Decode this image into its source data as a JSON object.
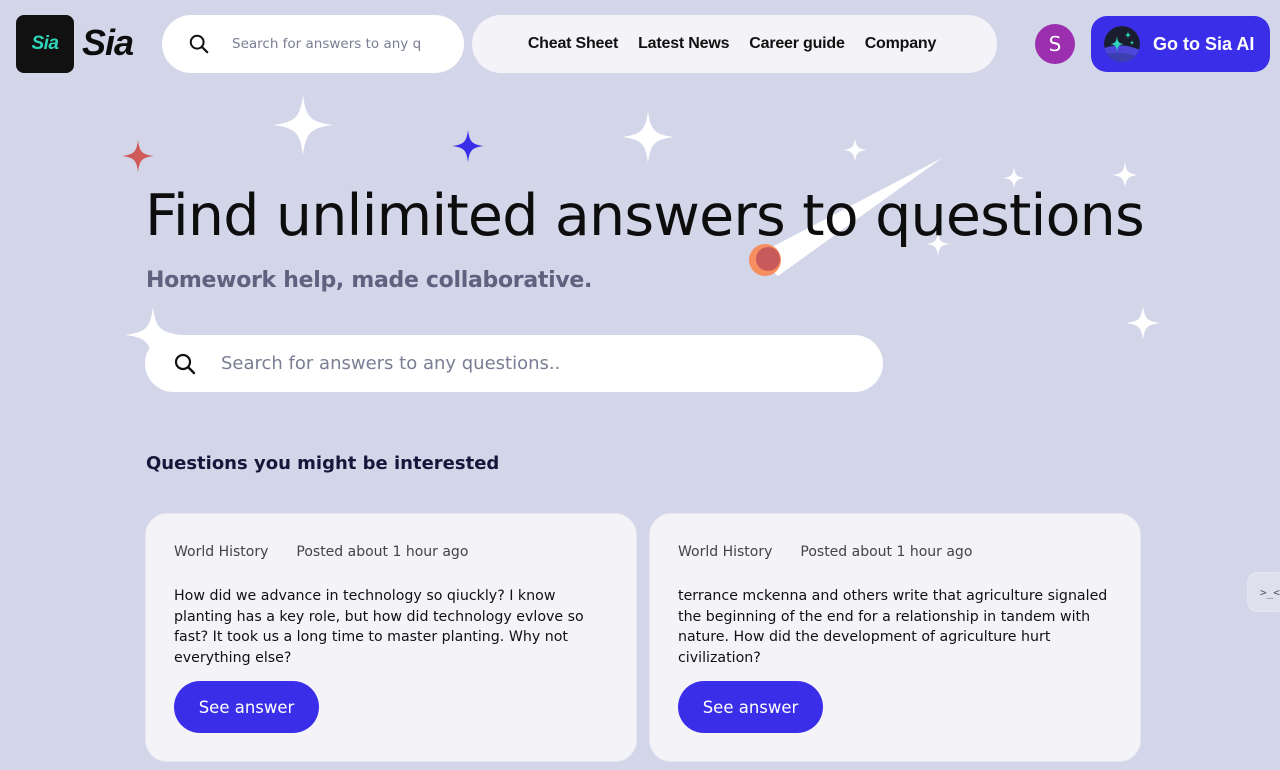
{
  "header": {
    "logo_badge_text": "Sia",
    "logo_wordmark": "Sia",
    "search": {
      "placeholder": "Search for answers to any questions..",
      "icon": "search-icon"
    },
    "nav": [
      {
        "label": "Cheat Sheet"
      },
      {
        "label": "Latest News"
      },
      {
        "label": "Career guide"
      },
      {
        "label": "Company"
      }
    ],
    "avatar_initial": "S",
    "cta": {
      "label": "Go to Sia AI",
      "icon": "sparkle-orb-icon"
    }
  },
  "hero": {
    "title": "Find unlimited answers to questions",
    "subtitle": "Homework help, made collaborative.",
    "search": {
      "placeholder": "Search for answers to any questions..",
      "icon": "search-icon"
    }
  },
  "questions": {
    "title": "Questions you might be interested",
    "items": [
      {
        "subject": "World History",
        "posted": "Posted about 1 hour ago",
        "text": "How did we advance in technology so qiuckly? I know planting has a key role, but how did technology evlove so fast? It took us a long time to master planting. Why not everything else?",
        "button": "See answer"
      },
      {
        "subject": "World History",
        "posted": "Posted about 1 hour ago",
        "text": "terrance mckenna and others write that agriculture signaled the beginning of the end for a relationship in tandem with nature. How did the development of agriculture hurt civilization?",
        "button": "See answer"
      }
    ]
  },
  "widget": {
    "label": ">_<"
  },
  "colors": {
    "background": "#d3d5e9",
    "accent": "#3a2ee8",
    "avatar": "#9b2fae",
    "logo_text": "#2fd3b8",
    "star_red": "#cf5a5a",
    "star_blue": "#3a2ee8",
    "comet_head": "#c85a5c",
    "comet_ring": "#f68e5f"
  }
}
